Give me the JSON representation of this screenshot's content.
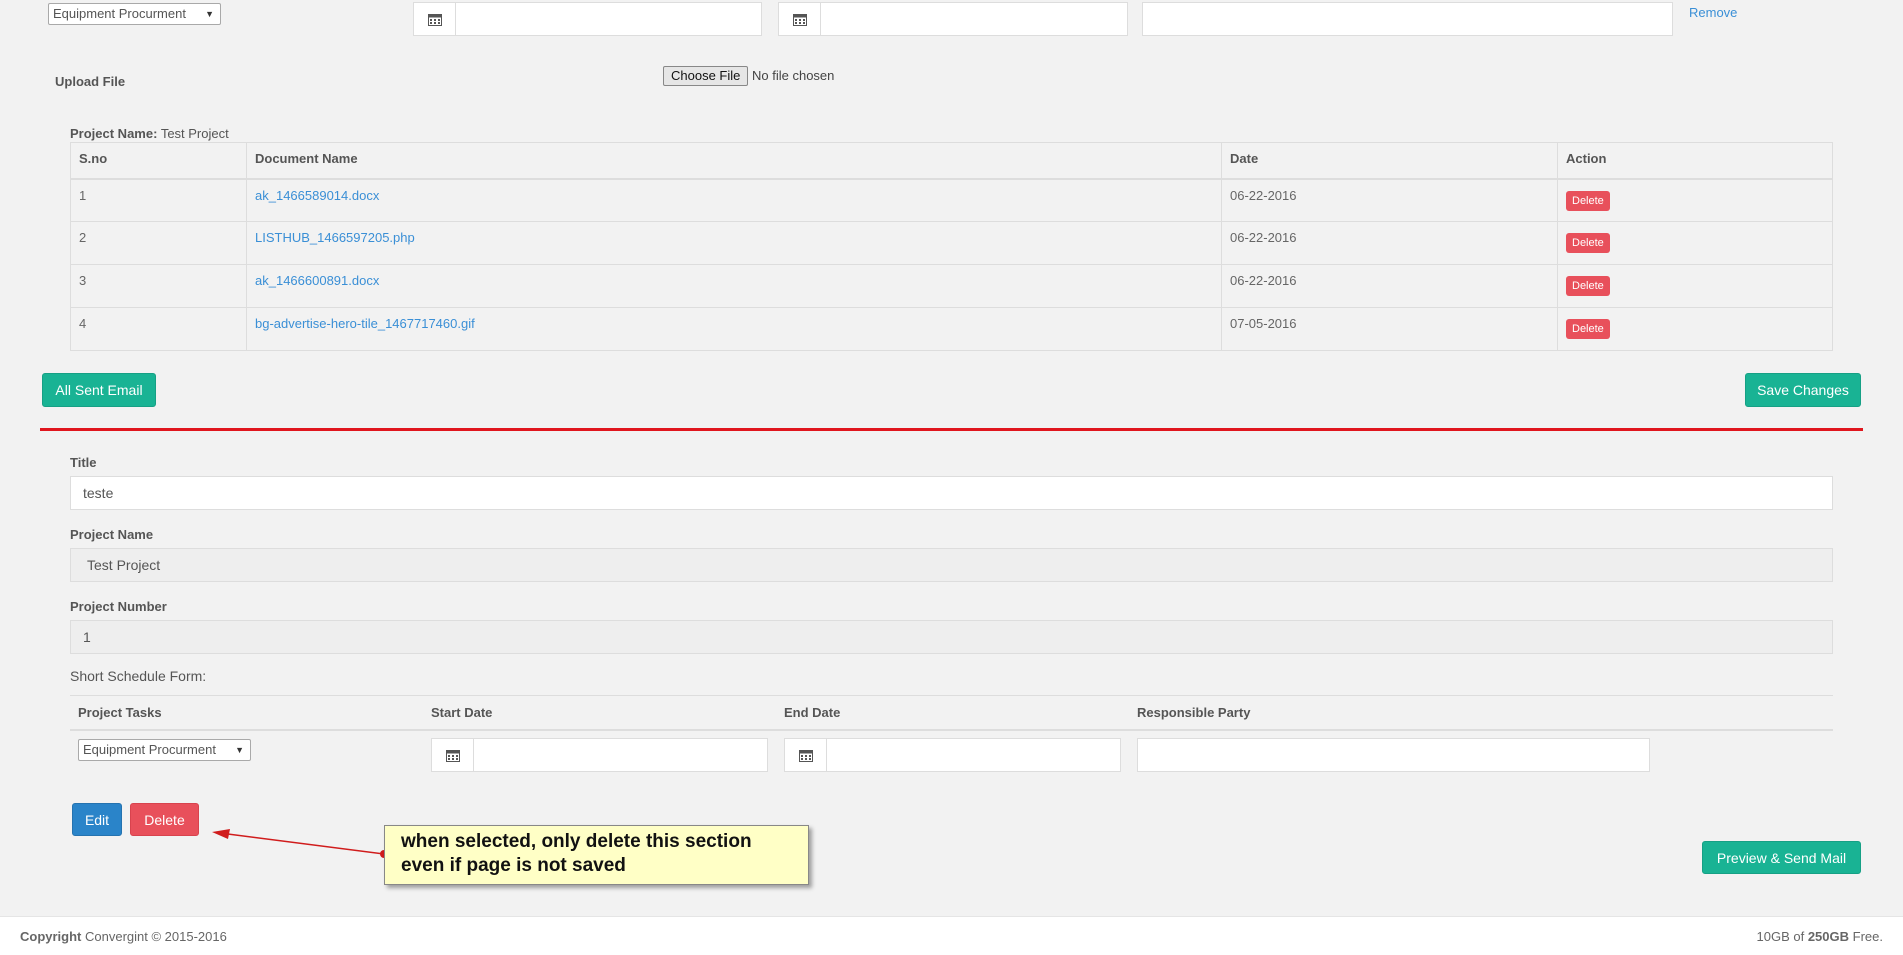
{
  "top_row": {
    "task_select": "Equipment Procurment",
    "remove_link": "Remove"
  },
  "upload": {
    "label": "Upload File",
    "choose_button": "Choose File",
    "status": "No file chosen"
  },
  "documents": {
    "project_label": "Project Name:",
    "project_value": "Test Project",
    "columns": [
      "S.no",
      "Document Name",
      "Date",
      "Action"
    ],
    "rows": [
      {
        "sno": "1",
        "name": "ak_1466589014.docx",
        "date": "06-22-2016",
        "action": "Delete"
      },
      {
        "sno": "2",
        "name": "LISTHUB_1466597205.php",
        "date": "06-22-2016",
        "action": "Delete"
      },
      {
        "sno": "3",
        "name": "ak_1466600891.docx",
        "date": "06-22-2016",
        "action": "Delete"
      },
      {
        "sno": "4",
        "name": "bg-advertise-hero-tile_1467717460.gif",
        "date": "07-05-2016",
        "action": "Delete"
      }
    ]
  },
  "actions": {
    "all_sent_email": "All Sent Email",
    "save_changes": "Save Changes"
  },
  "section": {
    "title_label": "Title",
    "title_value": "teste",
    "project_name_label": "Project Name",
    "project_name_value": "Test Project",
    "project_number_label": "Project Number",
    "project_number_value": "1",
    "schedule_label": "Short Schedule Form:",
    "schedule_columns": [
      "Project Tasks",
      "Start Date",
      "End Date",
      "Responsible Party"
    ],
    "task_select": "Equipment Procurment",
    "edit_button": "Edit",
    "delete_button": "Delete",
    "preview_button": "Preview & Send Mail"
  },
  "annotation": {
    "line1": "when selected, only delete this section",
    "line2": "even if page is not saved"
  },
  "footer": {
    "copyright_label": "Copyright",
    "copyright_text": "Convergint © 2015-2016",
    "storage_used": "10GB of",
    "storage_total": "250GB",
    "storage_suffix": "Free."
  },
  "colors": {
    "teal": "#19b394",
    "blue": "#2a84c9",
    "red": "#e8505b",
    "divider": "#e0161e",
    "link": "#3a8fd6"
  }
}
